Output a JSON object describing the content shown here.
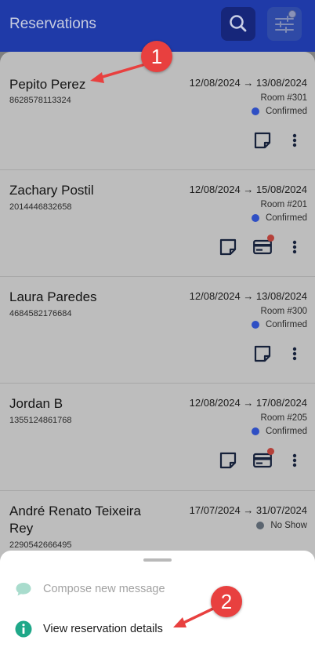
{
  "header": {
    "title": "Reservations",
    "search_icon": "search-icon",
    "filter_icon": "sliders-icon"
  },
  "reservations": [
    {
      "name": "Pepito Perez",
      "phone": "8628578113324",
      "dates": "12/08/2024 → 13/08/2024",
      "room": "Room #301",
      "status": "Confirmed",
      "status_color": "#2f4fc4",
      "has_payment": false
    },
    {
      "name": "Zachary Postil",
      "phone": "2014446832658",
      "dates": "12/08/2024 → 15/08/2024",
      "room": "Room #201",
      "status": "Confirmed",
      "status_color": "#2f4fc4",
      "has_payment": true
    },
    {
      "name": "Laura Paredes",
      "phone": "4684582176684",
      "dates": "12/08/2024 → 13/08/2024",
      "room": "Room #300",
      "status": "Confirmed",
      "status_color": "#2f4fc4",
      "has_payment": false
    },
    {
      "name": "Jordan B",
      "phone": "1355124861768",
      "dates": "12/08/2024 → 17/08/2024",
      "room": "Room #205",
      "status": "Confirmed",
      "status_color": "#2f4fc4",
      "has_payment": true
    },
    {
      "name": "André Renato Teixeira Rey",
      "phone": "2290542666495",
      "dates": "17/07/2024 → 31/07/2024",
      "room": "",
      "status": "No Show",
      "status_color": "#5b6570",
      "has_payment": false
    }
  ],
  "sheet": {
    "items": [
      {
        "label": "Compose new message",
        "icon": "chat-bubble-icon",
        "enabled": false
      },
      {
        "label": "View reservation details",
        "icon": "info-icon",
        "enabled": true
      }
    ]
  },
  "annotations": [
    "1",
    "2"
  ]
}
